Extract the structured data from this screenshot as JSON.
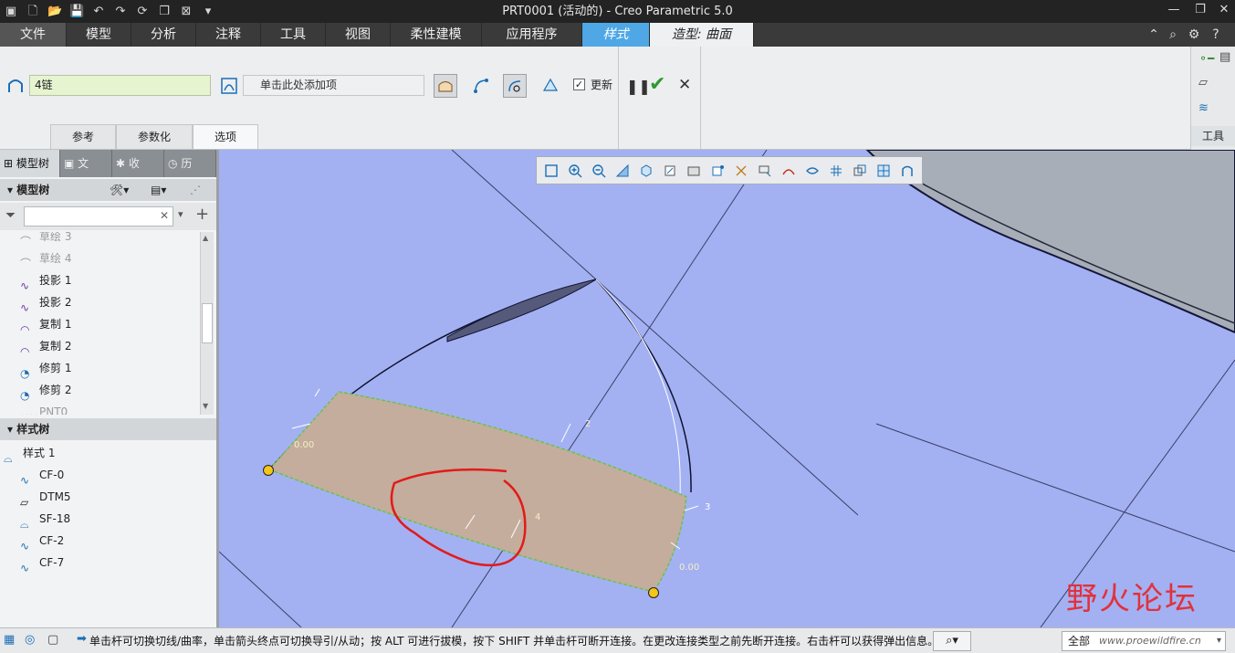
{
  "window": {
    "title": "PRT0001 (活动的) - Creo Parametric 5.0"
  },
  "menu": {
    "tabs": [
      "文件",
      "模型",
      "分析",
      "注释",
      "工具",
      "视图",
      "柔性建模",
      "应用程序",
      "样式",
      "造型: 曲面"
    ]
  },
  "ribbon": {
    "chain_value": "4链",
    "add_item_placeholder": "单击此处添加项",
    "update_label": "更新",
    "update_checked": true,
    "subtabs": [
      "参考",
      "参数化",
      "选项"
    ],
    "tools_label": "工具"
  },
  "left_panel": {
    "tabs": [
      "模型树",
      "文",
      "收",
      "历"
    ],
    "model_tree_header": "模型树",
    "model_tree_items": [
      "草绘 3",
      "草绘 4",
      "投影 1",
      "投影 2",
      "复制 1",
      "复制 2",
      "修剪 1",
      "修剪 2",
      "PNT0"
    ],
    "style_tree_header": "样式树",
    "style_tree_items": [
      "样式 1",
      "CF-0",
      "DTM5",
      "SF-18",
      "CF-2",
      "CF-7"
    ]
  },
  "viewport": {
    "labels": {
      "dim_top_left": "0.00",
      "dim_bottom_right": "0.00",
      "curve_2": "2",
      "curve_3": "3",
      "curve_4": "4"
    },
    "colors": {
      "background": "#a3b1f3",
      "surface": "#c4ad9d",
      "annotation": "#e31a1a",
      "endpoint": "#f5c518"
    }
  },
  "status": {
    "message": "单击杆可切换切线/曲率，单击箭头终点可切换导引/从动；按 ALT 可进行拔模，按下 SHIFT 并单击杆可断开连接。在更改连接类型之前先断开连接。右击杆可以获得弹出信息。",
    "filter_value": "全部"
  },
  "watermark": {
    "text": "野火论坛",
    "url": "www.proewildfire.cn"
  }
}
